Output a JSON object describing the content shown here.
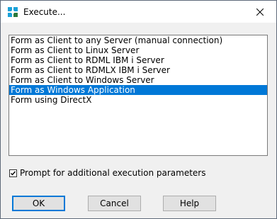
{
  "window": {
    "title": "Execute..."
  },
  "list": {
    "items": [
      "Form as Client to any Server (manual connection)",
      "Form as Client to Linux Server",
      "Form as Client to RDML IBM i Server",
      "Form as Client to RDMLX IBM i Server",
      "Form as Client to Windows Server",
      "Form as Windows Application",
      "Form using DirectX"
    ],
    "selected": "Form as Windows Application"
  },
  "options": {
    "prompt_label": "Prompt for additional execution parameters",
    "prompt_checked": true
  },
  "buttons": {
    "ok": "OK",
    "cancel": "Cancel",
    "help": "Help"
  },
  "colors": {
    "selection": "#0078d7",
    "default_button_border": "#0078d7"
  }
}
